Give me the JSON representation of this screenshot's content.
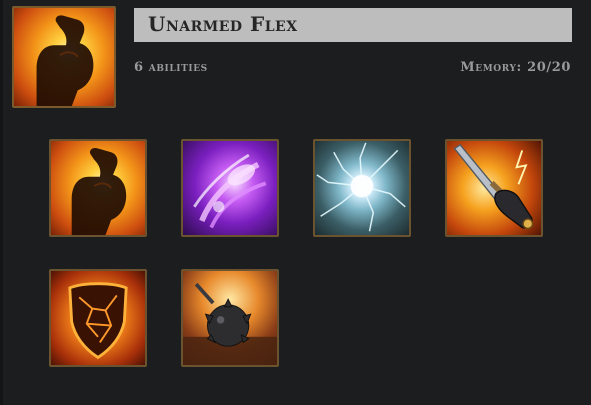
{
  "set": {
    "title": "Unarmed Flex",
    "ability_count_label": "6 abilities",
    "memory_label": "Memory: 20/20",
    "icon": "flexed-arm-icon"
  },
  "abilities": [
    {
      "icon": "flexed-arm-icon"
    },
    {
      "icon": "arcane-energy-icon"
    },
    {
      "icon": "lightning-burst-icon"
    },
    {
      "icon": "gauntlet-sword-icon"
    },
    {
      "icon": "molten-shield-icon"
    },
    {
      "icon": "spiked-bomb-icon"
    }
  ],
  "colors": {
    "background": "#1c1d1f",
    "title_bar": "#bdbdbd",
    "title_text": "#262626",
    "meta_text": "#9a9a9a",
    "slot_border": "#6b5330"
  }
}
